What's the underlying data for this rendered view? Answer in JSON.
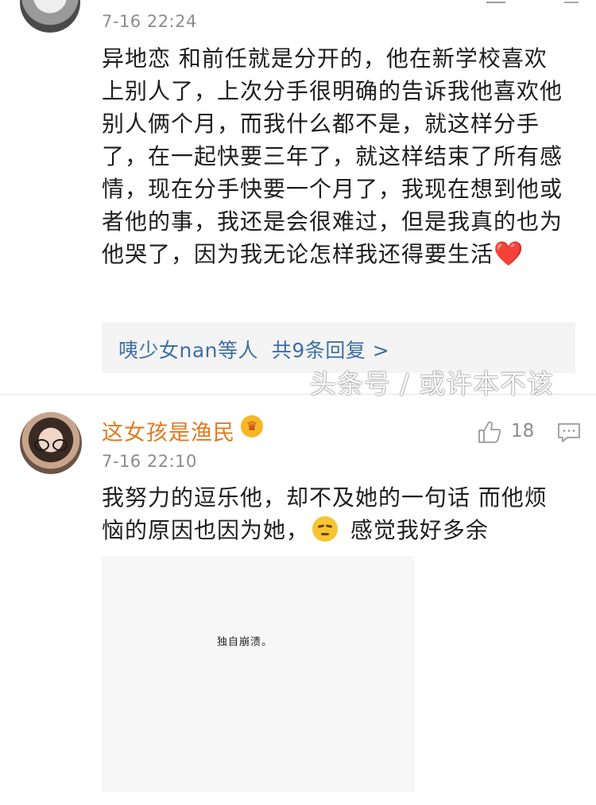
{
  "comment_1": {
    "time": "7-16 22:24",
    "text": "异地恋 和前任就是分开的，他在新学校喜欢上别人了，上次分手很明确的告诉我他喜欢他别人俩个月，而我什么都不是，就这样分手了，在一起快要三年了，就这样结束了所有感情，现在分手快要一个月了，我现在想到他或者他的事，我还是会很难过，但是我真的也为他哭了，因为我无论怎样我还得要生活",
    "emoji": "❤️",
    "replies": {
      "names": "咦少女nan等人",
      "count_text": "共9条回复",
      "arrow": ">"
    }
  },
  "comment_2": {
    "username": "这女孩是渔民",
    "badge_icon": "crown-icon",
    "time": "7-16 22:10",
    "likes": "18",
    "text_part1": "我努力的逗乐他，却不及她的一句话 而他烦恼的原因也因为她，",
    "text_part2": " 感觉我好多余",
    "image_caption": "独自崩溃。"
  },
  "watermark": "头条号 / 或许本不该",
  "colors": {
    "username": "#e07a1f",
    "reply_link": "#3d6fa6",
    "time": "#8c8c8c",
    "reply_box_bg": "#f4f4f4"
  }
}
